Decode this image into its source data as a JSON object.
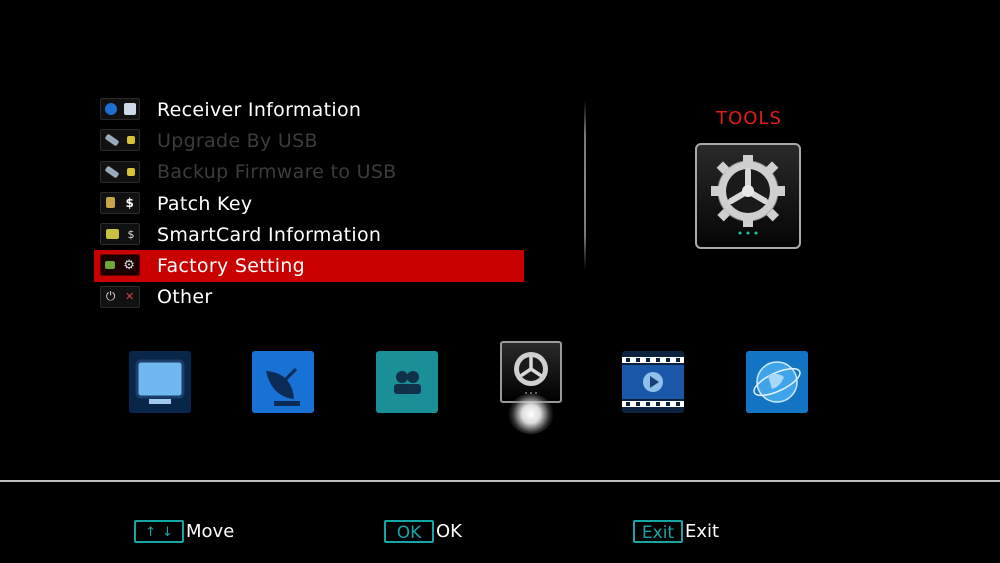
{
  "menu": {
    "items": [
      {
        "label": "Receiver Information",
        "state": "normal",
        "icon": "info-icon"
      },
      {
        "label": "Upgrade By USB",
        "state": "disabled",
        "icon": "usb-icon"
      },
      {
        "label": "Backup Firmware to USB",
        "state": "disabled",
        "icon": "usb-icon"
      },
      {
        "label": "Patch Key",
        "state": "normal",
        "icon": "key-lock-icon"
      },
      {
        "label": "SmartCard Information",
        "state": "normal",
        "icon": "smartcard-icon"
      },
      {
        "label": "Factory Setting",
        "state": "selected",
        "icon": "factory-reset-icon"
      },
      {
        "label": "Other",
        "state": "normal",
        "icon": "power-icon"
      }
    ]
  },
  "panel": {
    "title": "TOOLS",
    "icon": "gear-icon"
  },
  "apps": [
    {
      "name": "tv-icon"
    },
    {
      "name": "satellite-dish-icon"
    },
    {
      "name": "users-icon"
    },
    {
      "name": "gear-icon",
      "selected": true
    },
    {
      "name": "media-player-icon"
    },
    {
      "name": "globe-icon"
    }
  ],
  "footer": {
    "move": {
      "key": "↑↓",
      "label": "Move"
    },
    "ok": {
      "key": "OK",
      "label": "OK"
    },
    "exit": {
      "key": "Exit",
      "label": "Exit"
    }
  },
  "colors": {
    "accent": "#17a6a6",
    "selected": "#c80000",
    "title": "#e21b1b"
  }
}
